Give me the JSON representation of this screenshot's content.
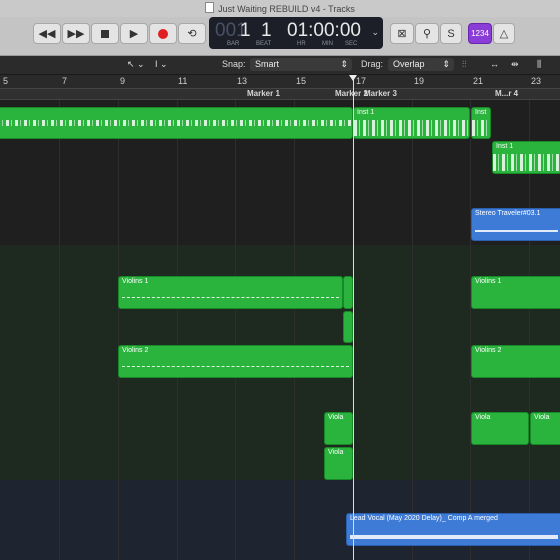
{
  "window": {
    "title": "Just Waiting REBUILD v4 - Tracks"
  },
  "transport": {
    "rewind_icon": "rewind-icon",
    "forward_icon": "fast-forward-icon",
    "stop_icon": "stop-icon",
    "play_icon": "play-icon",
    "record_icon": "record-icon",
    "cycle_icon": "cycle-icon"
  },
  "lcd": {
    "prefix": "001",
    "bar": "1",
    "beat": "1",
    "time": "01:00:00",
    "time_small": "00",
    "labels": {
      "bar": "BAR",
      "beat": "BEAT",
      "hr": "HR",
      "min": "MIN",
      "sec": "SEC"
    }
  },
  "right_controls": {
    "count_in": "1234",
    "s_label": "S"
  },
  "toolbar": {
    "snap_label": "Snap:",
    "snap_value": "Smart",
    "drag_label": "Drag:",
    "drag_value": "Overlap"
  },
  "ruler": {
    "numbers": [
      "5",
      "7",
      "9",
      "11",
      "13",
      "15",
      "17",
      "19",
      "21",
      "23"
    ]
  },
  "markers": [
    "Marker 1",
    "Marker 2",
    "Marker 3",
    "M...r 4"
  ],
  "regions": {
    "inst1_a": "Inst 1",
    "inst1_b": "Inst",
    "inst1_c": "Inst 1",
    "stereo": "Stereo Traveler#03.1",
    "violins1_a": "Violins 1",
    "violins1_b": "Violins 1",
    "violins2_a": "Violins 2",
    "violins2_b": "Violins 2",
    "viola_a": "Viola",
    "viola_b": "Viola",
    "viola_c": "Viola",
    "viola_d": "Viola",
    "lead_vocal": "Lead Vocal (May 2020 Delay)_ Comp A merged"
  },
  "colors": {
    "midi": "#2ab33d",
    "audio": "#3e7bd6",
    "count_in": "#8a3cd6"
  }
}
